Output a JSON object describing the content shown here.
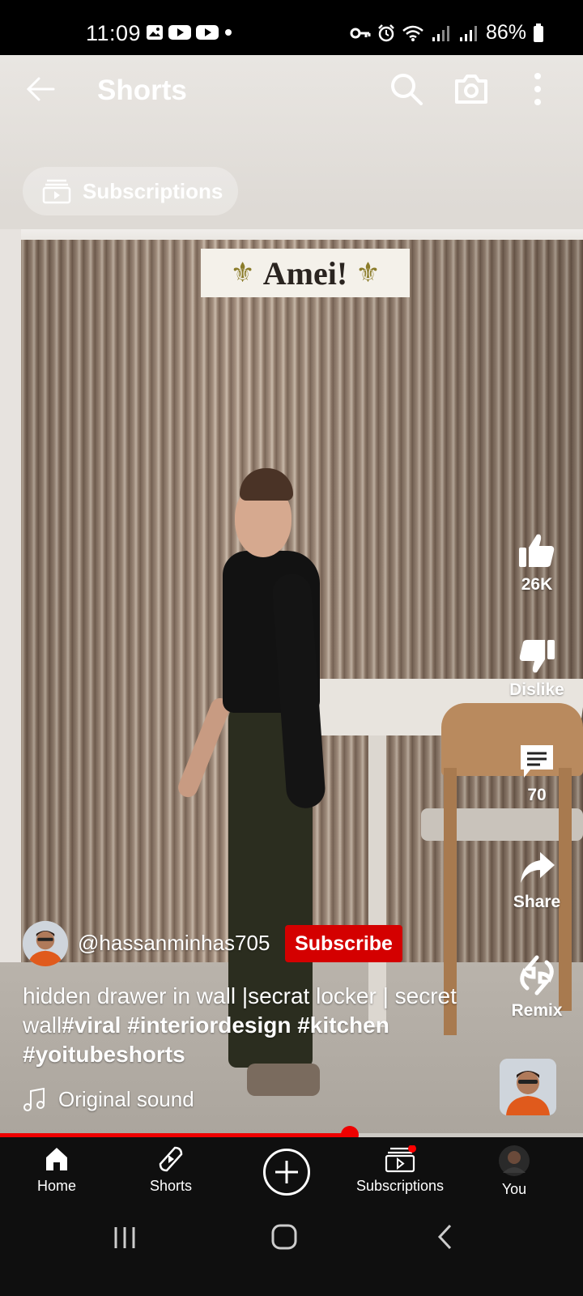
{
  "status_bar": {
    "time": "11:09",
    "battery": "86%"
  },
  "header": {
    "title": "Shorts"
  },
  "subscriptions_pill": {
    "label": "Subscriptions"
  },
  "video_overlay_text": "Amei!",
  "actions": {
    "like_count": "26K",
    "dislike_label": "Dislike",
    "comment_count": "70",
    "share_label": "Share",
    "remix_label": "Remix"
  },
  "channel": {
    "handle": "@hassanminhas705",
    "subscribe_label": "Subscribe"
  },
  "description": {
    "text_plain": "hidden drawer in wall |secrat locker | secret wall",
    "hashtag_1": "#viral",
    "hashtag_2": "#interiordesign",
    "hashtag_3": "#kitchen",
    "hashtag_4": "#yoitubeshorts"
  },
  "sound": {
    "label": "Original sound"
  },
  "progress": {
    "fraction": 0.6
  },
  "bottom_nav": {
    "home": "Home",
    "shorts": "Shorts",
    "subscriptions": "Subscriptions",
    "you": "You"
  },
  "colors": {
    "accent_red": "#d40000",
    "nav_bg": "#0f0f0f"
  }
}
